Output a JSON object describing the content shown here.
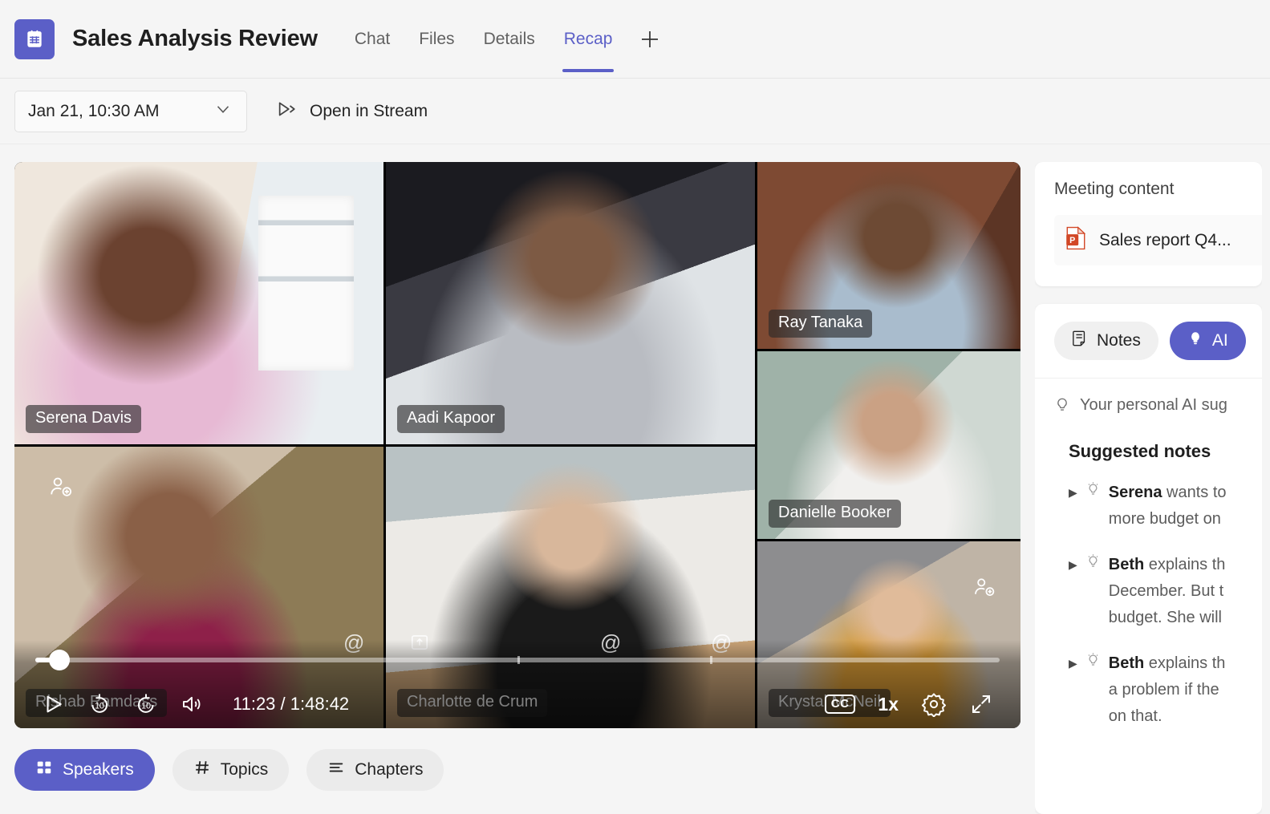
{
  "header": {
    "app_icon": "teams-meeting-icon",
    "title": "Sales Analysis Review",
    "tabs": [
      {
        "label": "Chat",
        "active": false
      },
      {
        "label": "Files",
        "active": false
      },
      {
        "label": "Details",
        "active": false
      },
      {
        "label": "Recap",
        "active": true
      }
    ],
    "add_tab_label": "+"
  },
  "toolbar": {
    "date_value": "Jan 21, 10:30 AM",
    "dropdown_icon": "chevron-down-icon",
    "open_in_stream_label": "Open in Stream",
    "open_in_stream_icon": "stream-play-icon"
  },
  "player": {
    "tiles": [
      {
        "name": "Serena Davis",
        "style": "v-serena"
      },
      {
        "name": "Aadi Kapoor",
        "style": "v-aadi"
      },
      {
        "name": "Ray Tanaka",
        "style": "v-ray"
      },
      {
        "name": "Danielle Booker",
        "style": "v-danielle"
      },
      {
        "name": "Rishab Ramdass",
        "style": "v-rishab"
      },
      {
        "name": "Charlotte de Crum",
        "style": "v-charlotte"
      },
      {
        "name": "Krystal McNeil",
        "style": "v-krystal"
      }
    ],
    "current_time": "11:23",
    "total_time": "1:48:42",
    "time_display": "11:23 / 1:48:42",
    "playback_speed": "1x",
    "progress_percent": 2.5,
    "controls": {
      "play_icon": "play-icon",
      "rewind_label": "10",
      "forward_label": "10",
      "volume_icon": "volume-icon",
      "captions_label": "CC",
      "settings_icon": "gear-icon",
      "fullscreen_icon": "fullscreen-icon"
    }
  },
  "view_pills": [
    {
      "label": "Speakers",
      "icon": "speakers-grid-icon",
      "active": true
    },
    {
      "label": "Topics",
      "icon": "hash-icon",
      "active": false
    },
    {
      "label": "Chapters",
      "icon": "list-lines-icon",
      "active": false
    }
  ],
  "right_panel": {
    "meeting_content": {
      "title": "Meeting content",
      "file_name": "Sales report Q4...",
      "file_icon": "powerpoint-icon"
    },
    "notes": {
      "toggles": [
        {
          "label": "Notes",
          "icon": "notes-icon",
          "active": false
        },
        {
          "label": "AI",
          "icon": "lightbulb-icon",
          "active": true
        }
      ],
      "hint": "Your personal AI sug",
      "hint_icon": "lightbulb-icon",
      "suggested_heading": "Suggested notes",
      "items": [
        {
          "speaker": "Serena",
          "text": " wants to",
          "lines": [
            "more budget on"
          ]
        },
        {
          "speaker": "Beth",
          "text": " explains th",
          "lines": [
            "December. But t",
            "budget. She will"
          ]
        },
        {
          "speaker": "Beth",
          "text": " explains th",
          "lines": [
            "a problem if the",
            "on that."
          ]
        }
      ]
    }
  },
  "colors": {
    "accent": "#5b5fc7",
    "page_bg": "#f5f5f5",
    "card_bg": "#ffffff",
    "text_primary": "#1f1f1f",
    "text_secondary": "#616161"
  }
}
